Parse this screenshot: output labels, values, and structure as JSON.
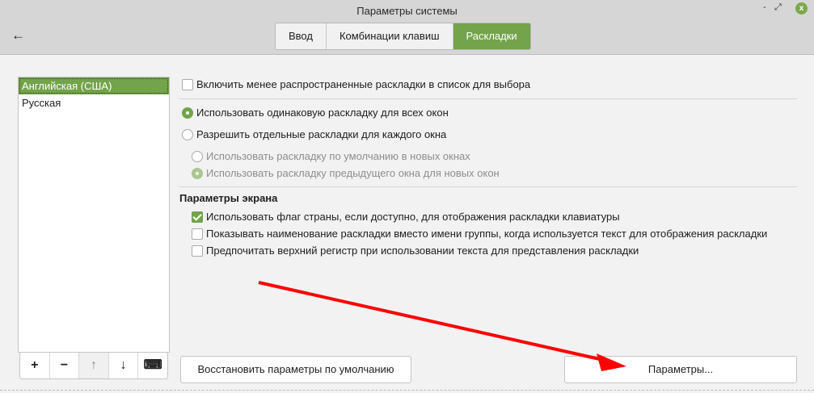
{
  "window": {
    "title": "Параметры системы",
    "minimize": "-",
    "maximize": "⤢",
    "close": "x"
  },
  "header": {
    "back": "←",
    "tabs": [
      {
        "label": "Ввод"
      },
      {
        "label": "Комбинации клавиш"
      },
      {
        "label": "Раскладки",
        "active": true
      }
    ]
  },
  "layouts": {
    "items": [
      "Английская (США)",
      "Русская"
    ],
    "selected": 0,
    "toolbar": {
      "add": "+",
      "remove": "−",
      "up": "↑",
      "down": "↓",
      "keyboard": "⌨"
    }
  },
  "options": {
    "include_exotic": {
      "label": "Включить менее распространенные раскладки в список для выбора",
      "checked": false
    },
    "same_layout": {
      "label": "Использовать одинаковую раскладку для всех окон",
      "selected": true
    },
    "per_window": {
      "label": "Разрешить отдельные раскладки для каждого окна",
      "selected": false
    },
    "default_new": {
      "label": "Использовать раскладку по умолчанию в новых окнах",
      "selected": false,
      "disabled": true
    },
    "prev_new": {
      "label": "Использовать раскладку предыдущего окна для новых окон",
      "selected": true,
      "disabled": true
    }
  },
  "screen": {
    "heading": "Параметры экрана",
    "flag": {
      "label": "Использовать флаг страны, если доступно, для отображения раскладки клавиатуры",
      "checked": true
    },
    "name": {
      "label": "Показывать наименование раскладки вместо имени группы, когда используется текст для отображения раскладки",
      "checked": false
    },
    "upper": {
      "label": "Предпочитать верхний регистр при использовании текста для представления раскладки",
      "checked": false
    }
  },
  "buttons": {
    "restore": "Восстановить параметры по умолчанию",
    "options": "Параметры..."
  },
  "colors": {
    "accent": "#73a34a",
    "annotation": "#ff0000"
  }
}
